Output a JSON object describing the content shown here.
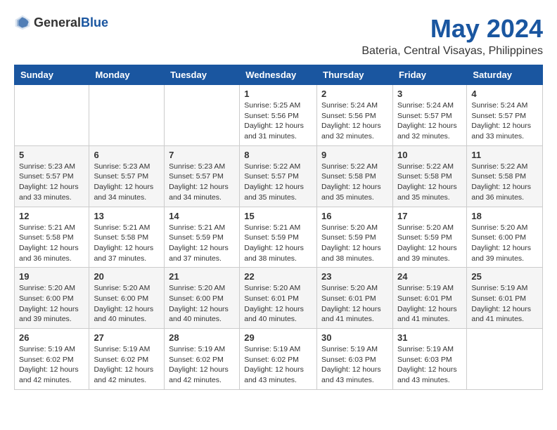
{
  "logo": {
    "general": "General",
    "blue": "Blue"
  },
  "title": {
    "month": "May 2024",
    "location": "Bateria, Central Visayas, Philippines"
  },
  "weekdays": [
    "Sunday",
    "Monday",
    "Tuesday",
    "Wednesday",
    "Thursday",
    "Friday",
    "Saturday"
  ],
  "weeks": [
    [
      {
        "day": "",
        "sunrise": "",
        "sunset": "",
        "daylight": ""
      },
      {
        "day": "",
        "sunrise": "",
        "sunset": "",
        "daylight": ""
      },
      {
        "day": "",
        "sunrise": "",
        "sunset": "",
        "daylight": ""
      },
      {
        "day": "1",
        "sunrise": "Sunrise: 5:25 AM",
        "sunset": "Sunset: 5:56 PM",
        "daylight": "Daylight: 12 hours and 31 minutes."
      },
      {
        "day": "2",
        "sunrise": "Sunrise: 5:24 AM",
        "sunset": "Sunset: 5:56 PM",
        "daylight": "Daylight: 12 hours and 32 minutes."
      },
      {
        "day": "3",
        "sunrise": "Sunrise: 5:24 AM",
        "sunset": "Sunset: 5:57 PM",
        "daylight": "Daylight: 12 hours and 32 minutes."
      },
      {
        "day": "4",
        "sunrise": "Sunrise: 5:24 AM",
        "sunset": "Sunset: 5:57 PM",
        "daylight": "Daylight: 12 hours and 33 minutes."
      }
    ],
    [
      {
        "day": "5",
        "sunrise": "Sunrise: 5:23 AM",
        "sunset": "Sunset: 5:57 PM",
        "daylight": "Daylight: 12 hours and 33 minutes."
      },
      {
        "day": "6",
        "sunrise": "Sunrise: 5:23 AM",
        "sunset": "Sunset: 5:57 PM",
        "daylight": "Daylight: 12 hours and 34 minutes."
      },
      {
        "day": "7",
        "sunrise": "Sunrise: 5:23 AM",
        "sunset": "Sunset: 5:57 PM",
        "daylight": "Daylight: 12 hours and 34 minutes."
      },
      {
        "day": "8",
        "sunrise": "Sunrise: 5:22 AM",
        "sunset": "Sunset: 5:57 PM",
        "daylight": "Daylight: 12 hours and 35 minutes."
      },
      {
        "day": "9",
        "sunrise": "Sunrise: 5:22 AM",
        "sunset": "Sunset: 5:58 PM",
        "daylight": "Daylight: 12 hours and 35 minutes."
      },
      {
        "day": "10",
        "sunrise": "Sunrise: 5:22 AM",
        "sunset": "Sunset: 5:58 PM",
        "daylight": "Daylight: 12 hours and 35 minutes."
      },
      {
        "day": "11",
        "sunrise": "Sunrise: 5:22 AM",
        "sunset": "Sunset: 5:58 PM",
        "daylight": "Daylight: 12 hours and 36 minutes."
      }
    ],
    [
      {
        "day": "12",
        "sunrise": "Sunrise: 5:21 AM",
        "sunset": "Sunset: 5:58 PM",
        "daylight": "Daylight: 12 hours and 36 minutes."
      },
      {
        "day": "13",
        "sunrise": "Sunrise: 5:21 AM",
        "sunset": "Sunset: 5:58 PM",
        "daylight": "Daylight: 12 hours and 37 minutes."
      },
      {
        "day": "14",
        "sunrise": "Sunrise: 5:21 AM",
        "sunset": "Sunset: 5:59 PM",
        "daylight": "Daylight: 12 hours and 37 minutes."
      },
      {
        "day": "15",
        "sunrise": "Sunrise: 5:21 AM",
        "sunset": "Sunset: 5:59 PM",
        "daylight": "Daylight: 12 hours and 38 minutes."
      },
      {
        "day": "16",
        "sunrise": "Sunrise: 5:20 AM",
        "sunset": "Sunset: 5:59 PM",
        "daylight": "Daylight: 12 hours and 38 minutes."
      },
      {
        "day": "17",
        "sunrise": "Sunrise: 5:20 AM",
        "sunset": "Sunset: 5:59 PM",
        "daylight": "Daylight: 12 hours and 39 minutes."
      },
      {
        "day": "18",
        "sunrise": "Sunrise: 5:20 AM",
        "sunset": "Sunset: 6:00 PM",
        "daylight": "Daylight: 12 hours and 39 minutes."
      }
    ],
    [
      {
        "day": "19",
        "sunrise": "Sunrise: 5:20 AM",
        "sunset": "Sunset: 6:00 PM",
        "daylight": "Daylight: 12 hours and 39 minutes."
      },
      {
        "day": "20",
        "sunrise": "Sunrise: 5:20 AM",
        "sunset": "Sunset: 6:00 PM",
        "daylight": "Daylight: 12 hours and 40 minutes."
      },
      {
        "day": "21",
        "sunrise": "Sunrise: 5:20 AM",
        "sunset": "Sunset: 6:00 PM",
        "daylight": "Daylight: 12 hours and 40 minutes."
      },
      {
        "day": "22",
        "sunrise": "Sunrise: 5:20 AM",
        "sunset": "Sunset: 6:01 PM",
        "daylight": "Daylight: 12 hours and 40 minutes."
      },
      {
        "day": "23",
        "sunrise": "Sunrise: 5:20 AM",
        "sunset": "Sunset: 6:01 PM",
        "daylight": "Daylight: 12 hours and 41 minutes."
      },
      {
        "day": "24",
        "sunrise": "Sunrise: 5:19 AM",
        "sunset": "Sunset: 6:01 PM",
        "daylight": "Daylight: 12 hours and 41 minutes."
      },
      {
        "day": "25",
        "sunrise": "Sunrise: 5:19 AM",
        "sunset": "Sunset: 6:01 PM",
        "daylight": "Daylight: 12 hours and 41 minutes."
      }
    ],
    [
      {
        "day": "26",
        "sunrise": "Sunrise: 5:19 AM",
        "sunset": "Sunset: 6:02 PM",
        "daylight": "Daylight: 12 hours and 42 minutes."
      },
      {
        "day": "27",
        "sunrise": "Sunrise: 5:19 AM",
        "sunset": "Sunset: 6:02 PM",
        "daylight": "Daylight: 12 hours and 42 minutes."
      },
      {
        "day": "28",
        "sunrise": "Sunrise: 5:19 AM",
        "sunset": "Sunset: 6:02 PM",
        "daylight": "Daylight: 12 hours and 42 minutes."
      },
      {
        "day": "29",
        "sunrise": "Sunrise: 5:19 AM",
        "sunset": "Sunset: 6:02 PM",
        "daylight": "Daylight: 12 hours and 43 minutes."
      },
      {
        "day": "30",
        "sunrise": "Sunrise: 5:19 AM",
        "sunset": "Sunset: 6:03 PM",
        "daylight": "Daylight: 12 hours and 43 minutes."
      },
      {
        "day": "31",
        "sunrise": "Sunrise: 5:19 AM",
        "sunset": "Sunset: 6:03 PM",
        "daylight": "Daylight: 12 hours and 43 minutes."
      },
      {
        "day": "",
        "sunrise": "",
        "sunset": "",
        "daylight": ""
      }
    ]
  ]
}
